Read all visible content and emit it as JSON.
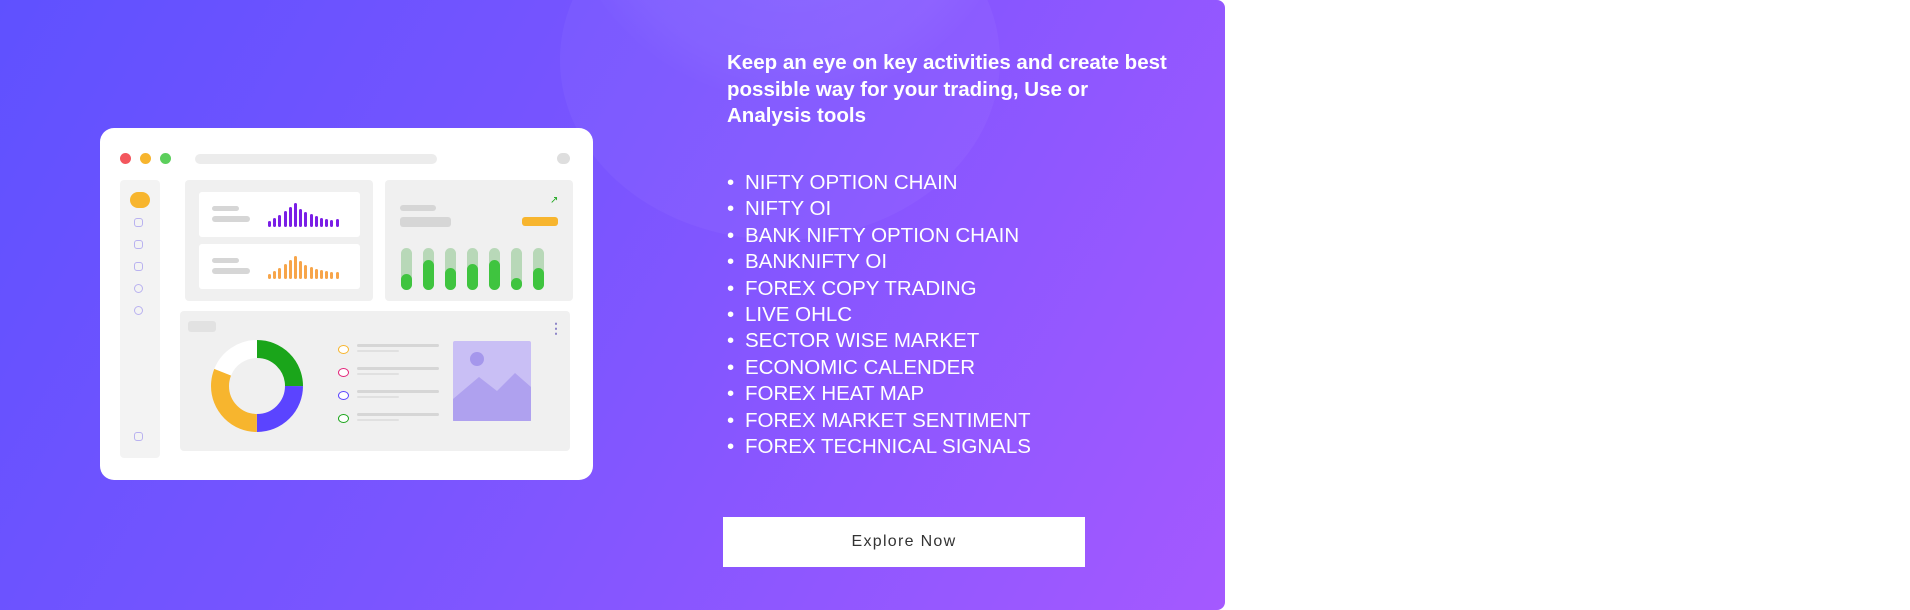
{
  "headline": "Keep an eye on key activities and create best possible way for your trading, Use or Analysis tools",
  "features": [
    "NIFTY OPTION CHAIN",
    "NIFTY OI",
    "BANK NIFTY OPTION CHAIN",
    "BANKNIFTY OI",
    "FOREX COPY TRADING",
    "LIVE OHLC",
    "SECTOR WISE MARKET",
    "ECONOMIC CALENDER",
    "FOREX HEAT MAP",
    "FOREX MARKET SENTIMENT",
    "FOREX TECHNICAL SIGNALS"
  ],
  "cta_label": "Explore Now",
  "colors": {
    "gradient_start": "#5f51ff",
    "gradient_end": "#a459ff",
    "accent_orange": "#f7b52e",
    "accent_green": "#1aa51a",
    "accent_indigo": "#5b44ff",
    "bar_purple": "#7a1fe6",
    "bar_orange": "#f7a54a"
  },
  "icons": {
    "window_controls": [
      "close-dot-icon",
      "minimize-dot-icon",
      "maximize-dot-icon"
    ],
    "sidebar": [
      "dashboard-icon",
      "copy-icon",
      "transfer-icon",
      "card-icon",
      "clock-icon",
      "settings-icon",
      "logout-icon"
    ],
    "trend": "arrow-up-right-icon",
    "menu": "more-vertical-icon",
    "image": "image-placeholder-icon"
  }
}
